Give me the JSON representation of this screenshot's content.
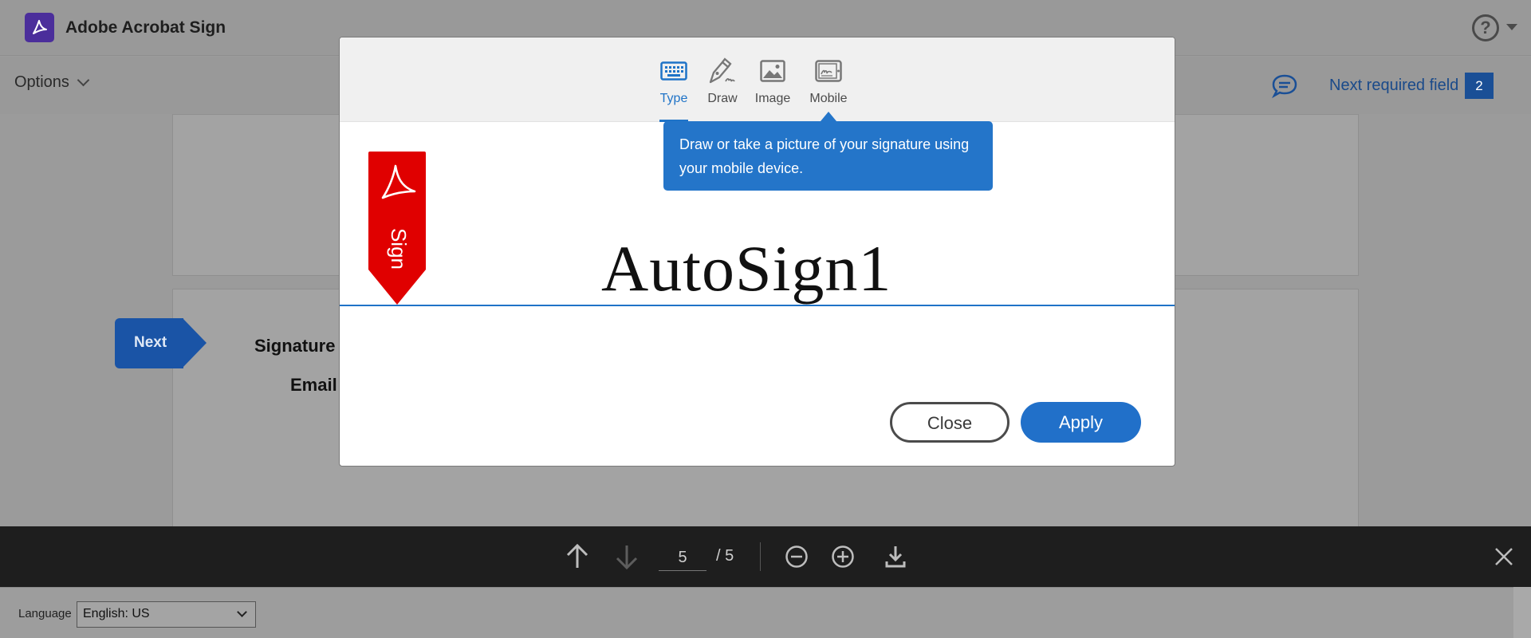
{
  "app": {
    "title": "Adobe Acrobat Sign"
  },
  "toolbar": {
    "options_label": "Options",
    "next_required_label": "Next required field",
    "next_required_count": "2"
  },
  "document": {
    "next_label": "Next",
    "field_labels": [
      "Signature",
      "Email"
    ]
  },
  "modal": {
    "tabs": [
      {
        "label": "Type",
        "icon": "keyboard-icon",
        "active": true
      },
      {
        "label": "Draw",
        "icon": "pen-icon",
        "active": false
      },
      {
        "label": "Image",
        "icon": "image-icon",
        "active": false
      },
      {
        "label": "Mobile",
        "icon": "mobile-icon",
        "active": false
      }
    ],
    "tooltip": "Draw or take a picture of your signature using your mobile device.",
    "sign_flag_label": "Sign",
    "signature_text": "AutoSign1",
    "close_label": "Close",
    "apply_label": "Apply"
  },
  "pager": {
    "current_page": "5",
    "total": "/ 5"
  },
  "footer": {
    "language_label": "Language",
    "language_value": "English: US"
  },
  "colors": {
    "accent": "#2170c9",
    "flag_red": "#e00000",
    "brand": "#4b2e9b"
  }
}
